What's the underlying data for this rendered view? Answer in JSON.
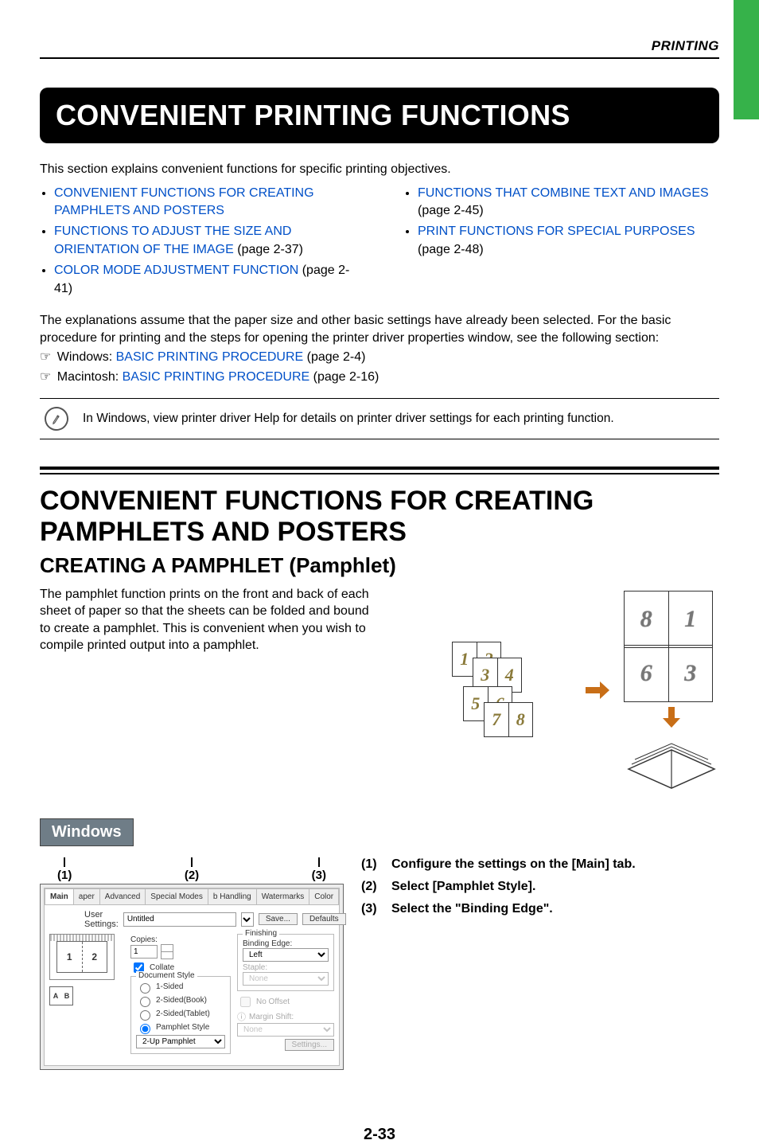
{
  "header": {
    "section": "PRINTING"
  },
  "title": "CONVENIENT PRINTING FUNCTIONS",
  "intro": "This section explains convenient functions for specific printing objectives.",
  "links": {
    "left": [
      {
        "text": "CONVENIENT FUNCTIONS FOR CREATING PAMPHLETS AND POSTERS",
        "suffix": ""
      },
      {
        "text": "FUNCTIONS TO ADJUST THE SIZE AND ORIENTATION OF THE IMAGE",
        "suffix": " (page 2-37)"
      },
      {
        "text": "COLOR MODE ADJUSTMENT FUNCTION",
        "suffix": " (page 2-41)"
      }
    ],
    "right": [
      {
        "text": "FUNCTIONS THAT COMBINE TEXT AND IMAGES",
        "suffix": " (page 2-45)"
      },
      {
        "text": "PRINT FUNCTIONS FOR SPECIAL PURPOSES",
        "suffix": " (page 2-48)"
      }
    ]
  },
  "explain": "The explanations assume that the paper size and other basic settings have already been selected. For the basic procedure for printing and the steps for opening the printer driver properties window, see the following section:",
  "pointers": {
    "win_prefix": "Windows: ",
    "mac_prefix": "Macintosh: ",
    "link_label": "BASIC PRINTING PROCEDURE",
    "win_page": " (page 2-4)",
    "mac_page": " (page 2-16)"
  },
  "note": "In Windows, view printer driver Help for details on printer driver settings for each printing function.",
  "h1": "CONVENIENT FUNCTIONS FOR CREATING PAMPHLETS AND POSTERS",
  "h2": "CREATING A PAMPHLET (Pamphlet)",
  "pamphlet_desc": "The pamphlet function prints on the front and back of each sheet of paper so that the sheets can be folded and bound to create a pamphlet. This is convenient when you wish to compile printed output into a pamphlet.",
  "os_badge": "Windows",
  "callouts": {
    "c1": "(1)",
    "c2": "(2)",
    "c3": "(3)"
  },
  "steps": {
    "s1": {
      "num": "(1)",
      "text": "Configure the settings on the [Main] tab."
    },
    "s2": {
      "num": "(2)",
      "text": "Select [Pamphlet Style]."
    },
    "s3": {
      "num": "(3)",
      "text": "Select the \"Binding Edge\"."
    }
  },
  "dialog": {
    "tabs": [
      "Main",
      "aper",
      "Advanced",
      "Special Modes",
      "b Handling",
      "Watermarks",
      "Color"
    ],
    "user_settings_label": "User Settings:",
    "user_settings_value": "Untitled",
    "save_btn": "Save...",
    "defaults_btn": "Defaults",
    "copies_label": "Copies:",
    "copies_value": "1",
    "collate_label": "Collate",
    "doc_style_legend": "Document Style",
    "opt_1sided": "1-Sided",
    "opt_2book": "2-Sided(Book)",
    "opt_2tablet": "2-Sided(Tablet)",
    "opt_pamphlet": "Pamphlet Style",
    "twoup_value": "2-Up Pamphlet",
    "finishing_legend": "Finishing",
    "binding_edge_label": "Binding Edge:",
    "binding_edge_value": "Left",
    "staple_label": "Staple:",
    "staple_value": "None",
    "nooffset_label": "No Offset",
    "margin_shift_label": "Margin Shift:",
    "margin_shift_value": "None",
    "settings_btn": "Settings...",
    "orient": {
      "a": "A",
      "b": "B"
    },
    "preview": {
      "p1": "1",
      "p2": "2"
    }
  },
  "diagram": {
    "sheets": [
      {
        "l": "1",
        "r": "2"
      },
      {
        "l": "3",
        "r": "4"
      },
      {
        "l": "5",
        "r": "6"
      },
      {
        "l": "7",
        "r": "8"
      }
    ],
    "spread": {
      "l": "8",
      "r": "1"
    },
    "spread2": {
      "l": "6",
      "r": "3"
    }
  },
  "page_number": "2-33"
}
